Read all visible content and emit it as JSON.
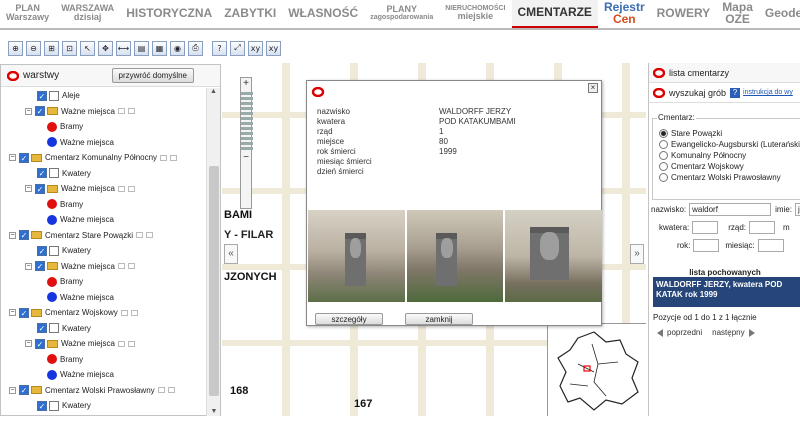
{
  "tabs": [
    {
      "line1": "PLAN",
      "line2": "Warszawy"
    },
    {
      "line1": "WARSZAWA",
      "line2": "dzisiaj"
    },
    {
      "line1": "HISTORYCZNA"
    },
    {
      "line1": "ZABYTKI"
    },
    {
      "line1": "WŁASNOŚĆ"
    },
    {
      "line1": "PLANY",
      "line2": "zagospodarowania"
    },
    {
      "line1": "NIERUCHOMOŚCI",
      "line2": "miejskie"
    },
    {
      "line1": "CMENTARZE"
    },
    {
      "line1a": "Rejestr ",
      "line1b": "Cen"
    },
    {
      "line1": "ROWERY"
    },
    {
      "line1": "Mapa OZE"
    },
    {
      "line1": "Geodezja"
    }
  ],
  "toolbar": {
    "icons": [
      "zoom-in-icon",
      "zoom-out-icon",
      "zoom-extent-icon",
      "zoom-window-icon",
      "pointer-icon",
      "pan-icon",
      "measure-icon",
      "select-icon",
      "layers-icon",
      "globe-icon",
      "print-icon",
      "help-icon",
      "fullscreen-icon",
      "coord-xy-icon",
      "coord-xy-icon-2"
    ],
    "glyphs": [
      "⊕",
      "⊖",
      "⊞",
      "⊡",
      "↖",
      "✥",
      "⟷",
      "▤",
      "▦",
      "◉",
      "⎙",
      "?",
      "⤢",
      "xy",
      "xy"
    ]
  },
  "layers": {
    "title": "warstwy",
    "reset_button": "przywróć domyślne",
    "rows": [
      {
        "level": 2,
        "type": "cb-white",
        "label": "Aleje"
      },
      {
        "level": 1,
        "type": "folder",
        "label": "Ważne miejsca",
        "mini": true
      },
      {
        "level": 3,
        "type": "red",
        "label": "Bramy"
      },
      {
        "level": 3,
        "type": "blue",
        "label": "Ważne miejsca"
      },
      {
        "level": 0,
        "type": "folder",
        "label": "Cmentarz Komunalny Północny",
        "mini": true
      },
      {
        "level": 2,
        "type": "cb-white",
        "label": "Kwatery"
      },
      {
        "level": 1,
        "type": "folder",
        "label": "Ważne miejsca",
        "mini": true
      },
      {
        "level": 3,
        "type": "red",
        "label": "Bramy"
      },
      {
        "level": 3,
        "type": "blue",
        "label": "Ważne miejsca"
      },
      {
        "level": 0,
        "type": "folder",
        "label": "Cmentarz Stare Powązki",
        "mini": true
      },
      {
        "level": 2,
        "type": "cb-white",
        "label": "Kwatery"
      },
      {
        "level": 1,
        "type": "folder",
        "label": "Ważne miejsca",
        "mini": true
      },
      {
        "level": 3,
        "type": "red",
        "label": "Bramy"
      },
      {
        "level": 3,
        "type": "blue",
        "label": "Ważne miejsca"
      },
      {
        "level": 0,
        "type": "folder",
        "label": "Cmentarz Wojskowy",
        "mini": true
      },
      {
        "level": 2,
        "type": "cb-white",
        "label": "Kwatery"
      },
      {
        "level": 1,
        "type": "folder",
        "label": "Ważne miejsca",
        "mini": true
      },
      {
        "level": 3,
        "type": "red",
        "label": "Bramy"
      },
      {
        "level": 3,
        "type": "blue",
        "label": "Ważne miejsca"
      },
      {
        "level": 0,
        "type": "folder",
        "label": "Cmentarz Wolski Prawosławny",
        "mini": true
      },
      {
        "level": 2,
        "type": "cb-white",
        "label": "Kwatery"
      },
      {
        "level": 1,
        "type": "folder",
        "label": "Ważne miejsca",
        "mini": true
      }
    ]
  },
  "map": {
    "labels": [
      "BAMI",
      "Y - FILAR",
      "JZONYCH",
      "168",
      "167"
    ]
  },
  "popup": {
    "fields": [
      {
        "k": "nazwisko",
        "v": "WALDORFF JERZY"
      },
      {
        "k": "kwatera",
        "v": "POD KATAKUMBAMI"
      },
      {
        "k": "rząd",
        "v": "1"
      },
      {
        "k": "miejsce",
        "v": "80"
      },
      {
        "k": "rok śmierci",
        "v": "1999"
      },
      {
        "k": "miesiąc śmierci",
        "v": ""
      },
      {
        "k": "dzień śmierci",
        "v": ""
      }
    ],
    "details_button": "szczegóły",
    "close_button": "zamknij"
  },
  "right": {
    "title": "lista cmentarzy",
    "search_title": "wyszukaj grób",
    "instr": "instrukcja do wy",
    "legend": "Cmentarz:",
    "cemeteries": [
      "Stare Powązki",
      "Ewangelicko-Augsburski (Luterański)",
      "Komunalny Północny",
      "Cmentarz Wojskowy",
      "Cmentarz Wolski Prawosławny"
    ],
    "nazwisko_label": "nazwisko:",
    "nazwisko_value": "waldorf",
    "imie_label": "imie:",
    "imie_value": "jer",
    "kwatera_label": "kwatera:",
    "rzad_label": "rząd:",
    "m_label": "m",
    "rok_label": "rok:",
    "miesiac_label": "miesiąc:",
    "list_title": "lista pochowanych",
    "result": "WALDORFF JERZY, kwatera POD KATAK rok 1999",
    "position": "Pozycje od 1 do 1 z 1 łącznie",
    "prev": "poprzedni",
    "next": "następny"
  }
}
